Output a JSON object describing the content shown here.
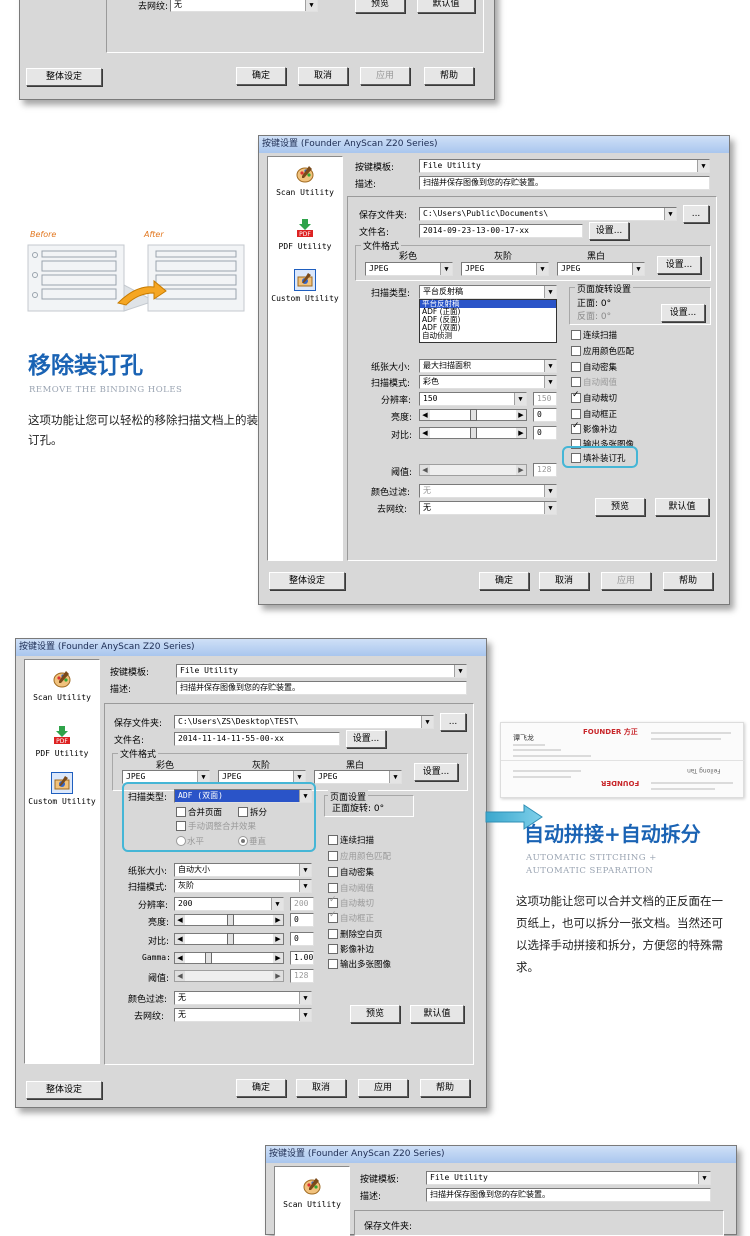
{
  "common": {
    "title": "按键设置 (Founder AnyScan Z20 Series)",
    "utilities": [
      "Scan Utility",
      "PDF Utility",
      "Custom Utility"
    ],
    "template_label": "按键模板:",
    "template_value": "File Utility",
    "desc_label": "描述:",
    "desc_value": "扫描并保存图像到您的存贮装置。",
    "save_folder_label": "保存文件夹:",
    "file_name_label": "文件名:",
    "file_format_label": "文件格式",
    "color_label": "彩色",
    "gray_label": "灰阶",
    "bw_label": "黑白",
    "jpeg": "JPEG",
    "settings_btn": "设置...",
    "browse_btn": "...",
    "scan_type_label": "扫描类型:",
    "paper_size_label": "纸张大小:",
    "scan_mode_label": "扫描模式:",
    "resolution_label": "分辨率:",
    "brightness_label": "亮度:",
    "contrast_label": "对比:",
    "gamma_label": "Gamma:",
    "threshold_label": "阈值:",
    "color_filter_label": "颜色过滤:",
    "descreen_label": "去网纹:",
    "none": "无",
    "preview_btn": "预览",
    "default_btn": "默认值",
    "global_settings_btn": "整体设定",
    "ok_btn": "确定",
    "cancel_btn": "取消",
    "apply_btn": "应用",
    "help_btn": "帮助",
    "page_rotation_label": "页面旋转设置",
    "page_rotation_label2": "页面设置",
    "front_label": "正面: 0°",
    "back_label": "反面: 0°",
    "front_rotation_label": "正面旋转: 0°",
    "zero": "0",
    "threshold_value": "128"
  },
  "dialog1": {
    "descreen_value": "无"
  },
  "dialog2": {
    "save_folder": "C:\\Users\\Public\\Documents\\",
    "file_name": "2014-09-23-13-00-17-xx",
    "scan_type": "平台反射稿",
    "scan_type_options": [
      "平台反射稿",
      "ADF (正面)",
      "ADF (反面)",
      "ADF (双面)",
      "自动侦测"
    ],
    "paper_size": "最大扫描面积",
    "scan_mode": "彩色",
    "resolution": "150",
    "resolution_disabled": "150",
    "checkboxes": [
      {
        "label": "连续扫描",
        "checked": false,
        "disabled": false
      },
      {
        "label": "应用颜色匹配",
        "checked": false,
        "disabled": false
      },
      {
        "label": "自动密集",
        "checked": false,
        "disabled": false
      },
      {
        "label": "自动阈值",
        "checked": false,
        "disabled": true
      },
      {
        "label": "自动裁切",
        "checked": true,
        "disabled": false
      },
      {
        "label": "自动框正",
        "checked": false,
        "disabled": false
      },
      {
        "label": "影像补边",
        "checked": true,
        "disabled": false
      },
      {
        "label": "输出多张图像",
        "checked": false,
        "disabled": false
      },
      {
        "label": "填补装订孔",
        "checked": false,
        "disabled": false
      }
    ],
    "before_label": "Before",
    "after_label": "After",
    "feature_title": "移除装订孔",
    "feature_sub": "REMOVE THE BINDING HOLES",
    "feature_text": "这项功能让您可以轻松的移除扫描文档上的装订孔。"
  },
  "dialog3": {
    "save_folder": "C:\\Users\\ZS\\Desktop\\TEST\\",
    "file_name": "2014-11-14-11-55-00-xx",
    "scan_type": "ADF (双面)",
    "merge_label": "合并页面",
    "split_label": "拆分",
    "manual_adjust_label": "手动调整合并效果",
    "horizontal_label": "水平",
    "vertical_label": "垂直",
    "paper_size": "自动大小",
    "scan_mode": "灰阶",
    "resolution": "200",
    "resolution_disabled": "200",
    "gamma": "1.00",
    "checkboxes": [
      {
        "label": "连续扫描",
        "checked": false,
        "disabled": false
      },
      {
        "label": "应用颜色匹配",
        "checked": false,
        "disabled": true
      },
      {
        "label": "自动密集",
        "checked": false,
        "disabled": false
      },
      {
        "label": "自动阈值",
        "checked": false,
        "disabled": true
      },
      {
        "label": "自动裁切",
        "checked": true,
        "disabled": true
      },
      {
        "label": "自动框正",
        "checked": true,
        "disabled": true
      },
      {
        "label": "删除空白页",
        "checked": false,
        "disabled": false
      },
      {
        "label": "影像补边",
        "checked": false,
        "disabled": false
      },
      {
        "label": "输出多张图像",
        "checked": false,
        "disabled": false
      }
    ],
    "card_name": "谭飞龙",
    "card_brand": "FOUNDER 方正",
    "card_brand_mirror": "FOUNDER",
    "card_name_mirror": "Feilong Tan",
    "feature_title": "自动拼接+自动拆分",
    "feature_sub1": "AUTOMATIC STITCHING +",
    "feature_sub2": "AUTOMATIC SEPARATION",
    "feature_text": "这项功能让您可以合并文档的正反面在一页纸上，也可以拆分一张文档。当然还可以选择手动拼接和拆分，方便您的特殊需求。"
  },
  "dialog4": {
    "save_folder_partial": "保存文件夹:"
  }
}
